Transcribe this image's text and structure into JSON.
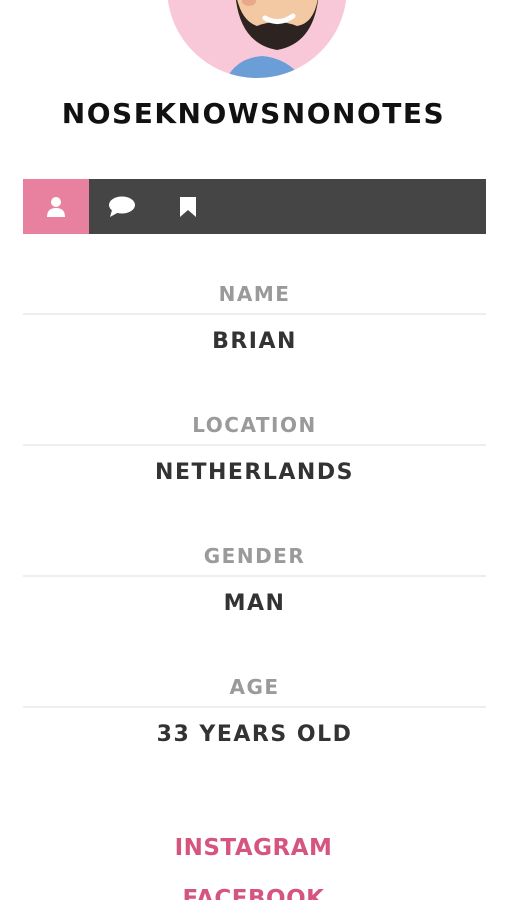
{
  "profile": {
    "username": "NOSEKNOWSNONOTES"
  },
  "tabs": [
    {
      "icon": "user-icon",
      "active": true
    },
    {
      "icon": "chat-bubble-icon",
      "active": false
    },
    {
      "icon": "bookmark-icon",
      "active": false
    }
  ],
  "fields": {
    "name": {
      "label": "NAME",
      "value": "BRIAN"
    },
    "location": {
      "label": "LOCATION",
      "value": "NETHERLANDS"
    },
    "gender": {
      "label": "GENDER",
      "value": "MAN"
    },
    "age": {
      "label": "AGE",
      "value": "33 YEARS OLD"
    }
  },
  "social": {
    "instagram": "INSTAGRAM",
    "facebook": "FACEBOOK"
  },
  "colors": {
    "accent": "#e8809f",
    "tabbar": "#454545",
    "link": "#d6557e"
  }
}
